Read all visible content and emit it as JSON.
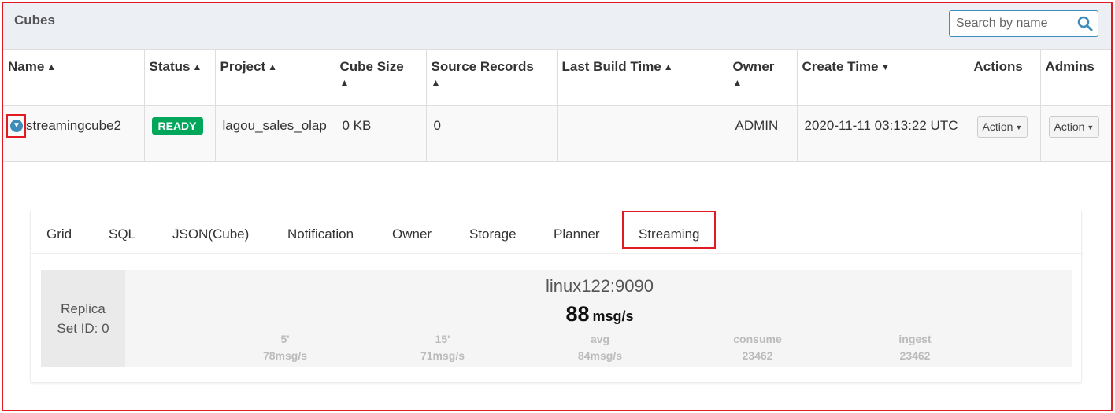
{
  "header": {
    "title": "Cubes",
    "search_placeholder": "Search by name"
  },
  "columns": {
    "name": "Name",
    "status": "Status",
    "project": "Project",
    "cube_size": "Cube Size",
    "source_records": "Source Records",
    "last_build_time": "Last Build Time",
    "owner": "Owner",
    "create_time": "Create Time",
    "actions": "Actions",
    "admins": "Admins"
  },
  "row": {
    "name": "streamingcube2",
    "status": "READY",
    "project": "lagou_sales_olap",
    "cube_size": "0 KB",
    "source_records": "0",
    "last_build_time": "",
    "owner": "ADMIN",
    "create_time": "2020-11-11 03:13:22 UTC",
    "actions_button": "Action",
    "admins_button": "Action"
  },
  "tabs": [
    "Grid",
    "SQL",
    "JSON(Cube)",
    "Notification",
    "Owner",
    "Storage",
    "Planner",
    "Streaming"
  ],
  "active_tab": "Streaming",
  "streaming": {
    "replica_label_line1": "Replica",
    "replica_label_line2": "Set ID: 0",
    "node": "linux122:9090",
    "rate_value": "88",
    "rate_unit": "msg/s",
    "metrics": [
      {
        "label": "5'",
        "value": "78msg/s"
      },
      {
        "label": "15'",
        "value": "71msg/s"
      },
      {
        "label": "avg",
        "value": "84msg/s"
      },
      {
        "label": "consume",
        "value": "23462"
      },
      {
        "label": "ingest",
        "value": "23462"
      }
    ]
  },
  "colors": {
    "highlight_border": "#e01b24",
    "ready_badge": "#00a65a",
    "accent": "#3c8dbc",
    "header_bg": "#ecf0f5"
  }
}
